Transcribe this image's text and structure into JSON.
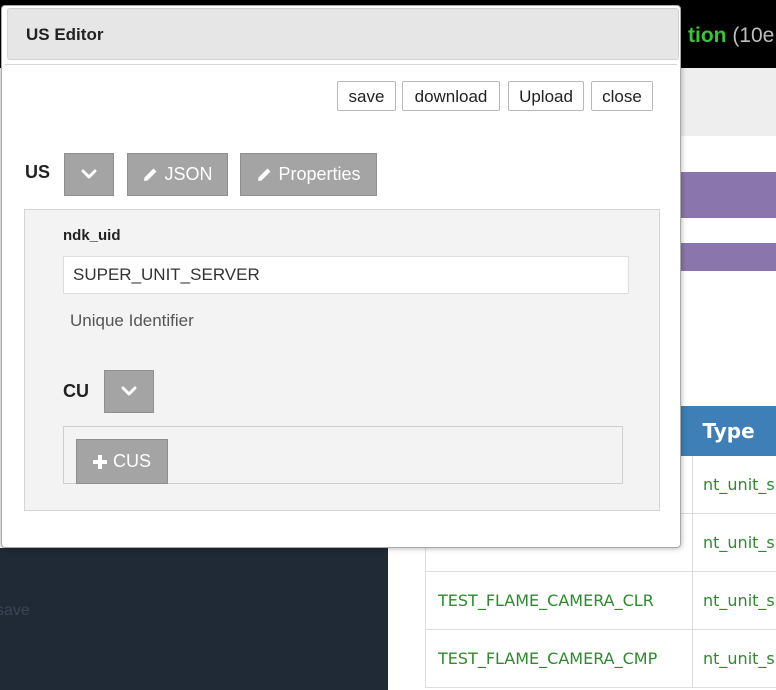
{
  "background": {
    "title_highlight": "tion",
    "title_rest": " (10e",
    "ghost_text": "save",
    "table": {
      "headers": [
        "",
        "Type"
      ],
      "rows": [
        [
          "",
          "nt_unit_s"
        ],
        [
          "",
          "nt_unit_s"
        ],
        [
          "TEST_FLAME_CAMERA_CLR",
          "nt_unit_s"
        ],
        [
          "TEST_FLAME_CAMERA_CMP",
          "nt_unit_s"
        ]
      ]
    }
  },
  "modal": {
    "title": "US Editor",
    "toolbar": {
      "save_label": "save",
      "download_label": "download",
      "upload_label": "Upload",
      "close_label": "close"
    },
    "us_label": "US",
    "json_label": "JSON",
    "properties_label": "Properties",
    "field": {
      "label": "ndk_uid",
      "value": "SUPER_UNIT_SERVER",
      "help": "Unique Identifier"
    },
    "cu_label": "CU",
    "add_cus_label": "CUS"
  },
  "colors": {
    "accent_green": "#39c339",
    "table_header_blue": "#3f7fb7",
    "purple_bar": "#8a76ac",
    "button_gray": "#a4a4a4"
  },
  "icons": {
    "chevron": "chevron-down-icon",
    "pencil": "pencil-icon",
    "plus": "plus-icon"
  }
}
